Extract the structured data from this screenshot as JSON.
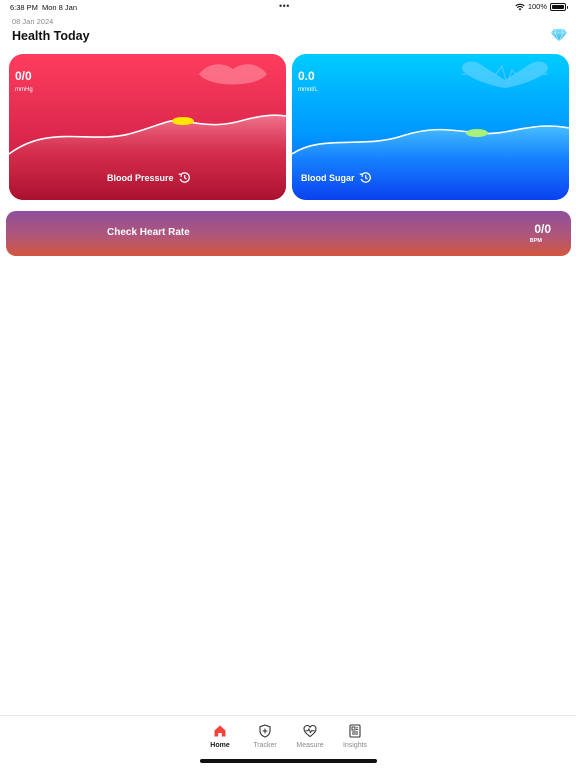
{
  "status_bar": {
    "time": "6:38 PM",
    "date": "Mon 8 Jan",
    "battery": "100%",
    "battery_level": 1.0
  },
  "header": {
    "date": "08 Jan 2024",
    "title": "Health Today",
    "premium_icon": "diamond-icon"
  },
  "cards": {
    "blood_pressure": {
      "value": "0/0",
      "unit": "mmHg",
      "label": "Blood Pressure",
      "icon": "history-icon",
      "deco_icon": "lips-icon",
      "colors": {
        "top": "#ff3d5e",
        "bottom": "#b51433",
        "marker": "#ffe600"
      }
    },
    "blood_sugar": {
      "value": "0.0",
      "unit": "mmol/L",
      "label": "Blood Sugar",
      "icon": "history-icon",
      "deco_icon": "heartbeat-icon",
      "colors": {
        "top": "#00ccff",
        "bottom": "#0a4df2",
        "marker": "#a8f07a"
      }
    }
  },
  "heart_rate": {
    "title": "Check Heart Rate",
    "value": "0/0",
    "unit": "BPM"
  },
  "tab_bar": {
    "active": "Home",
    "items": [
      {
        "label": "Home",
        "icon": "home-icon"
      },
      {
        "label": "Tracker",
        "icon": "shield-plus-icon"
      },
      {
        "label": "Measure",
        "icon": "heart-pulse-icon"
      },
      {
        "label": "Insights",
        "icon": "document-icon"
      }
    ],
    "accent_color": "#f5423f"
  }
}
